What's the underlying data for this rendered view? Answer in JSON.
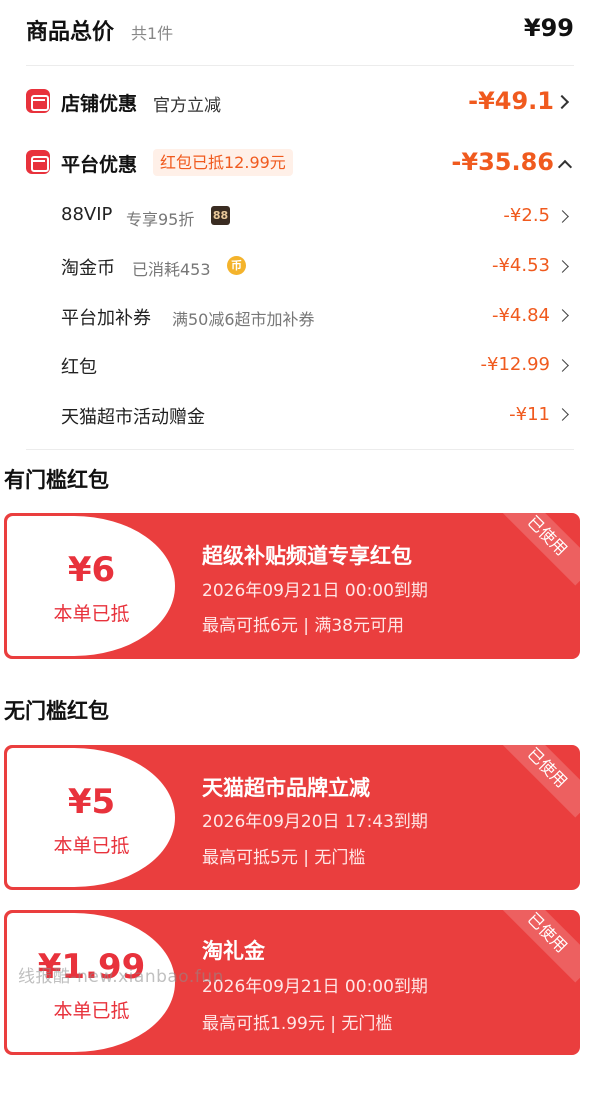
{
  "summary": {
    "title": "商品总价",
    "count": "共1件",
    "total": "¥99"
  },
  "store_discount": {
    "label": "店铺优惠",
    "sub": "官方立减",
    "amount": "-¥49.1"
  },
  "platform_discount": {
    "label": "平台优惠",
    "tag": "红包已抵12.99元",
    "amount": "-¥35.86",
    "items": [
      {
        "label": "88VIP",
        "hint": "专享95折",
        "badge": "88",
        "amount": "-¥2.5"
      },
      {
        "label": "淘金币",
        "hint": "已消耗453",
        "badge": "币",
        "amount": "-¥4.53"
      },
      {
        "label": "平台加补券",
        "hint": "满50减6超市加补券",
        "amount": "-¥4.84"
      },
      {
        "label": "红包",
        "hint": "",
        "amount": "-¥12.99"
      },
      {
        "label": "天猫超市活动赠金",
        "hint": "",
        "amount": "-¥11"
      }
    ]
  },
  "threshold_section": {
    "title": "有门槛红包",
    "coupons": [
      {
        "value": "¥6",
        "applied": "本单已抵",
        "title": "超级补贴频道专享红包",
        "expire": "2026年09月21日 00:00到期",
        "rules": "最高可抵6元 | 满38元可用",
        "stamp": "已使用"
      }
    ]
  },
  "no_threshold_section": {
    "title": "无门槛红包",
    "coupons": [
      {
        "value": "¥5",
        "applied": "本单已抵",
        "title": "天猫超市品牌立减",
        "expire": "2026年09月20日 17:43到期",
        "rules": "最高可抵5元 | 无门槛",
        "stamp": "已使用"
      },
      {
        "value": "¥1.99",
        "applied": "本单已抵",
        "title": "淘礼金",
        "expire": "2026年09月21日 00:00到期",
        "rules": "最高可抵1.99元 | 无门槛",
        "stamp": "已使用"
      }
    ]
  },
  "watermark": "线报酷-new.xianbao.fun",
  "colors": {
    "accent": "#e8323c",
    "discount": "#f05a1e",
    "coupon_bg": "#ea3e3e"
  }
}
